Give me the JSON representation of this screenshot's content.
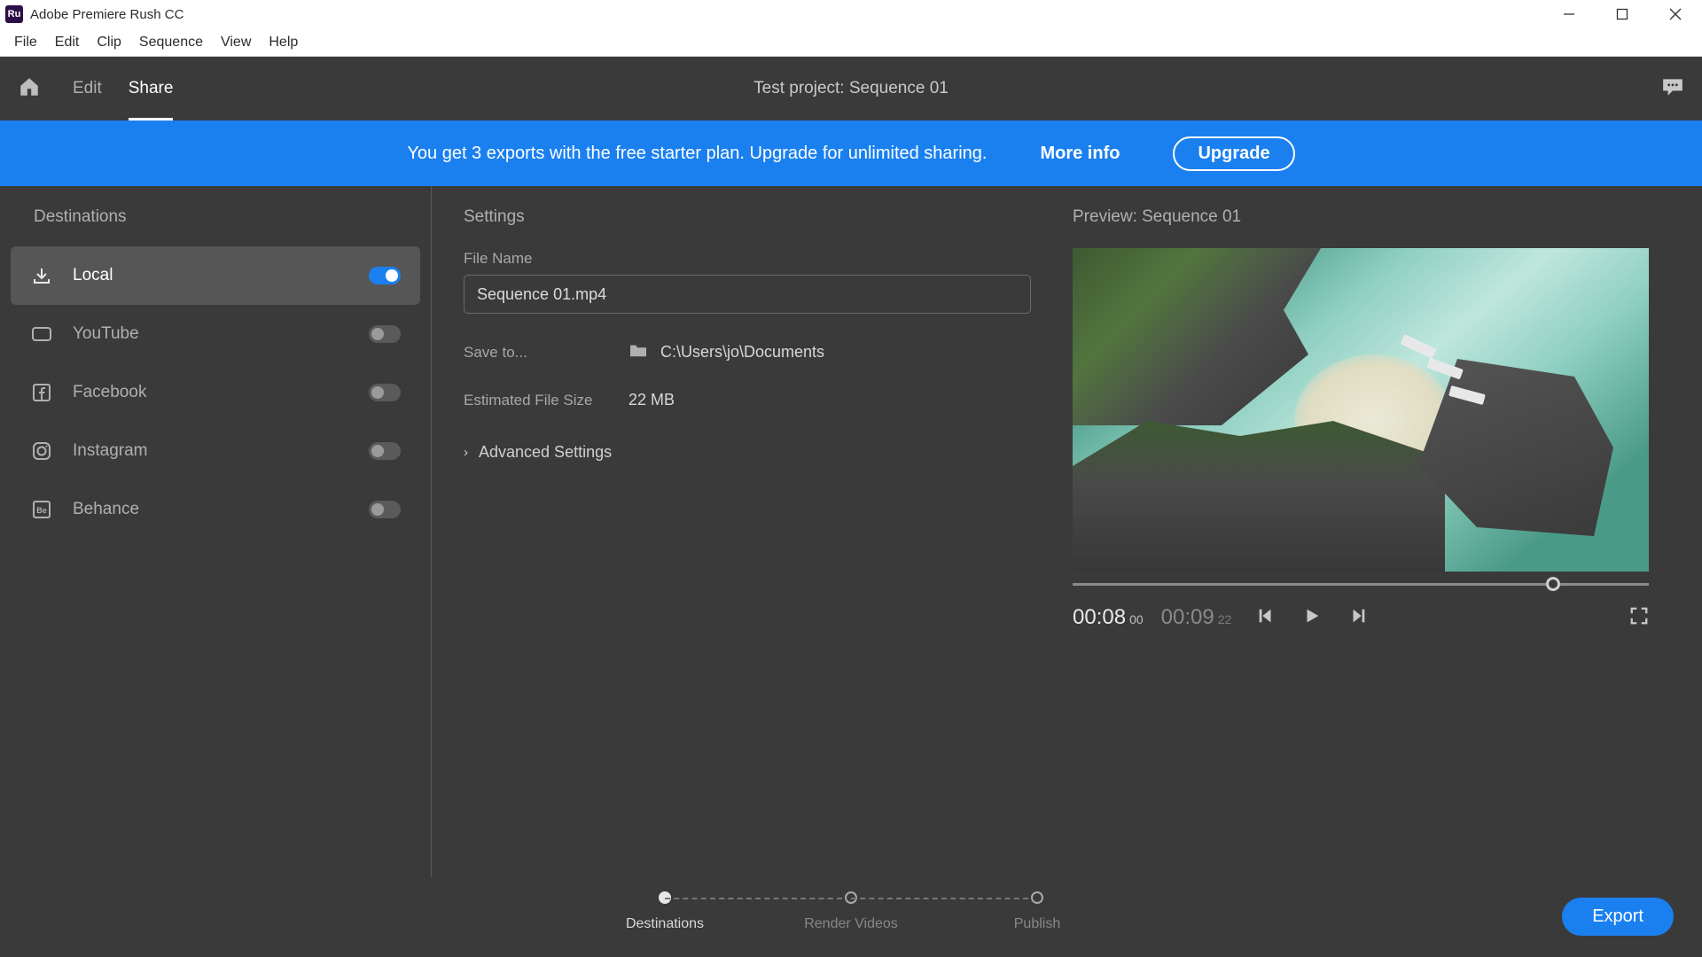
{
  "window": {
    "title": "Adobe Premiere Rush CC",
    "logo_text": "Ru"
  },
  "menu": [
    "File",
    "Edit",
    "Clip",
    "Sequence",
    "View",
    "Help"
  ],
  "header": {
    "tabs": {
      "edit": "Edit",
      "share": "Share"
    },
    "project": "Test project: Sequence 01"
  },
  "banner": {
    "message": "You get 3 exports with the free starter plan. Upgrade for unlimited sharing.",
    "more_info": "More info",
    "upgrade": "Upgrade"
  },
  "sidebar": {
    "header": "Destinations",
    "items": [
      {
        "label": "Local",
        "on": true,
        "icon": "download"
      },
      {
        "label": "YouTube",
        "on": false,
        "icon": "youtube"
      },
      {
        "label": "Facebook",
        "on": false,
        "icon": "facebook"
      },
      {
        "label": "Instagram",
        "on": false,
        "icon": "instagram"
      },
      {
        "label": "Behance",
        "on": false,
        "icon": "behance"
      }
    ]
  },
  "settings": {
    "header": "Settings",
    "file_name_label": "File Name",
    "file_name_value": "Sequence 01.mp4",
    "save_to_label": "Save to...",
    "save_to_value": "C:\\Users\\jo\\Documents",
    "est_label": "Estimated File Size",
    "est_value": "22 MB",
    "advanced": "Advanced Settings"
  },
  "preview": {
    "header": "Preview: Sequence 01",
    "cur_time": "00:08",
    "cur_frames": "00",
    "dur_time": "00:09",
    "dur_frames": "22"
  },
  "stepper": {
    "steps": [
      "Destinations",
      "Render Videos",
      "Publish"
    ]
  },
  "export_btn": "Export"
}
